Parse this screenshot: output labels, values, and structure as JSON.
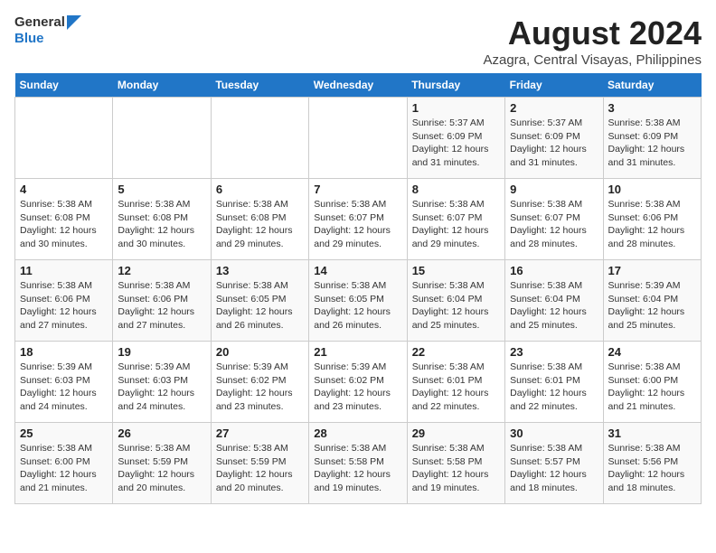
{
  "logo": {
    "general": "General",
    "blue": "Blue"
  },
  "title": "August 2024",
  "subtitle": "Azagra, Central Visayas, Philippines",
  "days_of_week": [
    "Sunday",
    "Monday",
    "Tuesday",
    "Wednesday",
    "Thursday",
    "Friday",
    "Saturday"
  ],
  "weeks": [
    [
      {
        "num": "",
        "info": ""
      },
      {
        "num": "",
        "info": ""
      },
      {
        "num": "",
        "info": ""
      },
      {
        "num": "",
        "info": ""
      },
      {
        "num": "1",
        "info": "Sunrise: 5:37 AM\nSunset: 6:09 PM\nDaylight: 12 hours\nand 31 minutes."
      },
      {
        "num": "2",
        "info": "Sunrise: 5:37 AM\nSunset: 6:09 PM\nDaylight: 12 hours\nand 31 minutes."
      },
      {
        "num": "3",
        "info": "Sunrise: 5:38 AM\nSunset: 6:09 PM\nDaylight: 12 hours\nand 31 minutes."
      }
    ],
    [
      {
        "num": "4",
        "info": "Sunrise: 5:38 AM\nSunset: 6:08 PM\nDaylight: 12 hours\nand 30 minutes."
      },
      {
        "num": "5",
        "info": "Sunrise: 5:38 AM\nSunset: 6:08 PM\nDaylight: 12 hours\nand 30 minutes."
      },
      {
        "num": "6",
        "info": "Sunrise: 5:38 AM\nSunset: 6:08 PM\nDaylight: 12 hours\nand 29 minutes."
      },
      {
        "num": "7",
        "info": "Sunrise: 5:38 AM\nSunset: 6:07 PM\nDaylight: 12 hours\nand 29 minutes."
      },
      {
        "num": "8",
        "info": "Sunrise: 5:38 AM\nSunset: 6:07 PM\nDaylight: 12 hours\nand 29 minutes."
      },
      {
        "num": "9",
        "info": "Sunrise: 5:38 AM\nSunset: 6:07 PM\nDaylight: 12 hours\nand 28 minutes."
      },
      {
        "num": "10",
        "info": "Sunrise: 5:38 AM\nSunset: 6:06 PM\nDaylight: 12 hours\nand 28 minutes."
      }
    ],
    [
      {
        "num": "11",
        "info": "Sunrise: 5:38 AM\nSunset: 6:06 PM\nDaylight: 12 hours\nand 27 minutes."
      },
      {
        "num": "12",
        "info": "Sunrise: 5:38 AM\nSunset: 6:06 PM\nDaylight: 12 hours\nand 27 minutes."
      },
      {
        "num": "13",
        "info": "Sunrise: 5:38 AM\nSunset: 6:05 PM\nDaylight: 12 hours\nand 26 minutes."
      },
      {
        "num": "14",
        "info": "Sunrise: 5:38 AM\nSunset: 6:05 PM\nDaylight: 12 hours\nand 26 minutes."
      },
      {
        "num": "15",
        "info": "Sunrise: 5:38 AM\nSunset: 6:04 PM\nDaylight: 12 hours\nand 25 minutes."
      },
      {
        "num": "16",
        "info": "Sunrise: 5:38 AM\nSunset: 6:04 PM\nDaylight: 12 hours\nand 25 minutes."
      },
      {
        "num": "17",
        "info": "Sunrise: 5:39 AM\nSunset: 6:04 PM\nDaylight: 12 hours\nand 25 minutes."
      }
    ],
    [
      {
        "num": "18",
        "info": "Sunrise: 5:39 AM\nSunset: 6:03 PM\nDaylight: 12 hours\nand 24 minutes."
      },
      {
        "num": "19",
        "info": "Sunrise: 5:39 AM\nSunset: 6:03 PM\nDaylight: 12 hours\nand 24 minutes."
      },
      {
        "num": "20",
        "info": "Sunrise: 5:39 AM\nSunset: 6:02 PM\nDaylight: 12 hours\nand 23 minutes."
      },
      {
        "num": "21",
        "info": "Sunrise: 5:39 AM\nSunset: 6:02 PM\nDaylight: 12 hours\nand 23 minutes."
      },
      {
        "num": "22",
        "info": "Sunrise: 5:38 AM\nSunset: 6:01 PM\nDaylight: 12 hours\nand 22 minutes."
      },
      {
        "num": "23",
        "info": "Sunrise: 5:38 AM\nSunset: 6:01 PM\nDaylight: 12 hours\nand 22 minutes."
      },
      {
        "num": "24",
        "info": "Sunrise: 5:38 AM\nSunset: 6:00 PM\nDaylight: 12 hours\nand 21 minutes."
      }
    ],
    [
      {
        "num": "25",
        "info": "Sunrise: 5:38 AM\nSunset: 6:00 PM\nDaylight: 12 hours\nand 21 minutes."
      },
      {
        "num": "26",
        "info": "Sunrise: 5:38 AM\nSunset: 5:59 PM\nDaylight: 12 hours\nand 20 minutes."
      },
      {
        "num": "27",
        "info": "Sunrise: 5:38 AM\nSunset: 5:59 PM\nDaylight: 12 hours\nand 20 minutes."
      },
      {
        "num": "28",
        "info": "Sunrise: 5:38 AM\nSunset: 5:58 PM\nDaylight: 12 hours\nand 19 minutes."
      },
      {
        "num": "29",
        "info": "Sunrise: 5:38 AM\nSunset: 5:58 PM\nDaylight: 12 hours\nand 19 minutes."
      },
      {
        "num": "30",
        "info": "Sunrise: 5:38 AM\nSunset: 5:57 PM\nDaylight: 12 hours\nand 18 minutes."
      },
      {
        "num": "31",
        "info": "Sunrise: 5:38 AM\nSunset: 5:56 PM\nDaylight: 12 hours\nand 18 minutes."
      }
    ]
  ]
}
